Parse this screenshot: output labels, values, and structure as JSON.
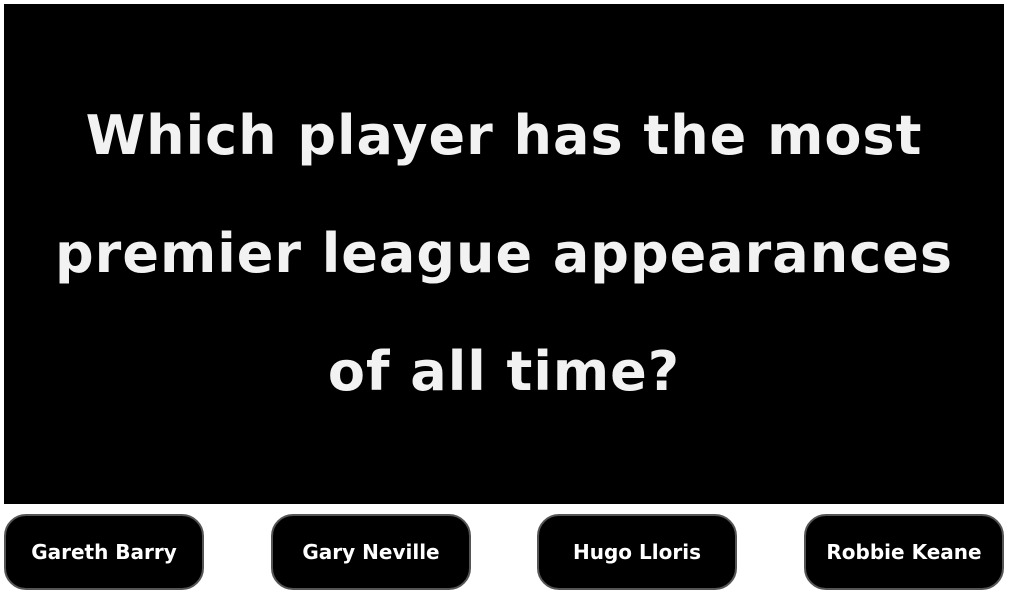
{
  "quiz": {
    "question": "Which player has the most premier league appearances of all time?",
    "answers": [
      {
        "label": "Gareth Barry"
      },
      {
        "label": "Gary Neville"
      },
      {
        "label": "Hugo Lloris"
      },
      {
        "label": "Robbie Keane"
      }
    ]
  },
  "colors": {
    "panel_background": "#000000",
    "question_text": "#f2f2f2",
    "button_background": "#000000",
    "button_text": "#ffffff",
    "button_border": "#555555"
  }
}
